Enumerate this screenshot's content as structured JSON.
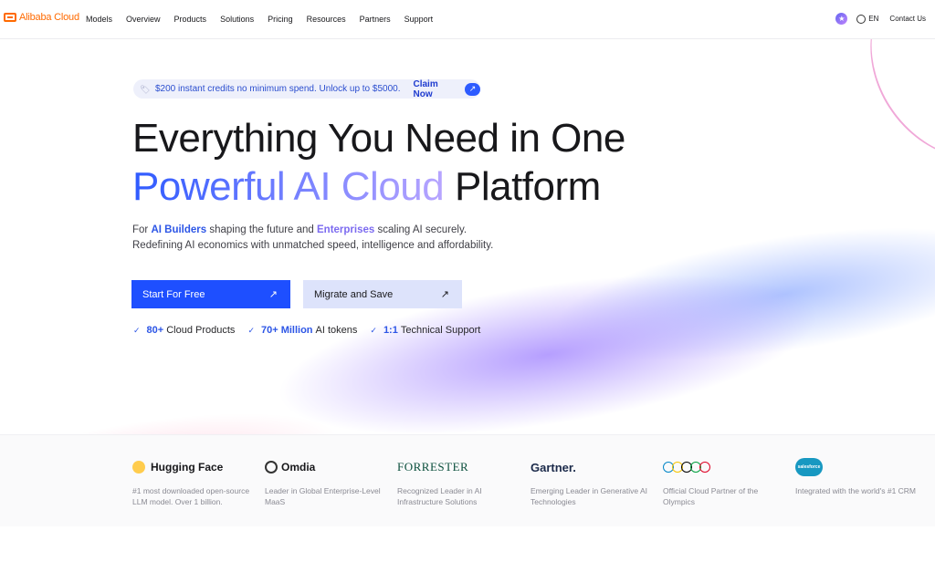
{
  "header": {
    "logo_text": "Alibaba Cloud",
    "nav": [
      "Models",
      "Overview",
      "Products",
      "Solutions",
      "Pricing",
      "Resources",
      "Partners",
      "Support"
    ],
    "lang": "EN",
    "contact": "Contact Us"
  },
  "promo": {
    "text": "$200 instant credits no minimum spend. Unlock up to $5000.",
    "cta": "Claim Now"
  },
  "hero": {
    "line1": "Everything You Need in One",
    "line2_gradient": "Powerful AI Cloud",
    "line2_plain": " Platform",
    "sub_prefix": "For ",
    "sub_ai_builders": "AI Builders",
    "sub_mid": " shaping the future and ",
    "sub_enterprises": "Enterprises",
    "sub_suffix": " scaling AI securely.",
    "sub_line2": "Redefining AI economics with unmatched speed, intelligence and affordability."
  },
  "buttons": {
    "primary": "Start For Free",
    "secondary": "Migrate and Save"
  },
  "stats": [
    {
      "num": "80+",
      "label": "Cloud Products"
    },
    {
      "num": "70+ Million",
      "label": "AI tokens"
    },
    {
      "num": "1:1",
      "label": "Technical Support"
    }
  ],
  "partners": [
    {
      "name": "Hugging Face",
      "desc": "#1 most downloaded open-source LLM model. Over 1 billion."
    },
    {
      "name": "Omdia",
      "desc": "Leader in Global Enterprise-Level MaaS"
    },
    {
      "name": "FORRESTER",
      "desc": "Recognized Leader in AI Infrastructure Solutions"
    },
    {
      "name": "Gartner.",
      "desc": "Emerging Leader in Generative AI Technologies"
    },
    {
      "name": "",
      "desc": "Official Cloud Partner of the Olympics"
    },
    {
      "name": "salesforce",
      "desc": "Integrated with the world's #1 CRM"
    }
  ],
  "colors": {
    "brand_orange": "#ff6a00",
    "primary_blue": "#1e4fff",
    "accent_purple": "#7c6bf0"
  }
}
